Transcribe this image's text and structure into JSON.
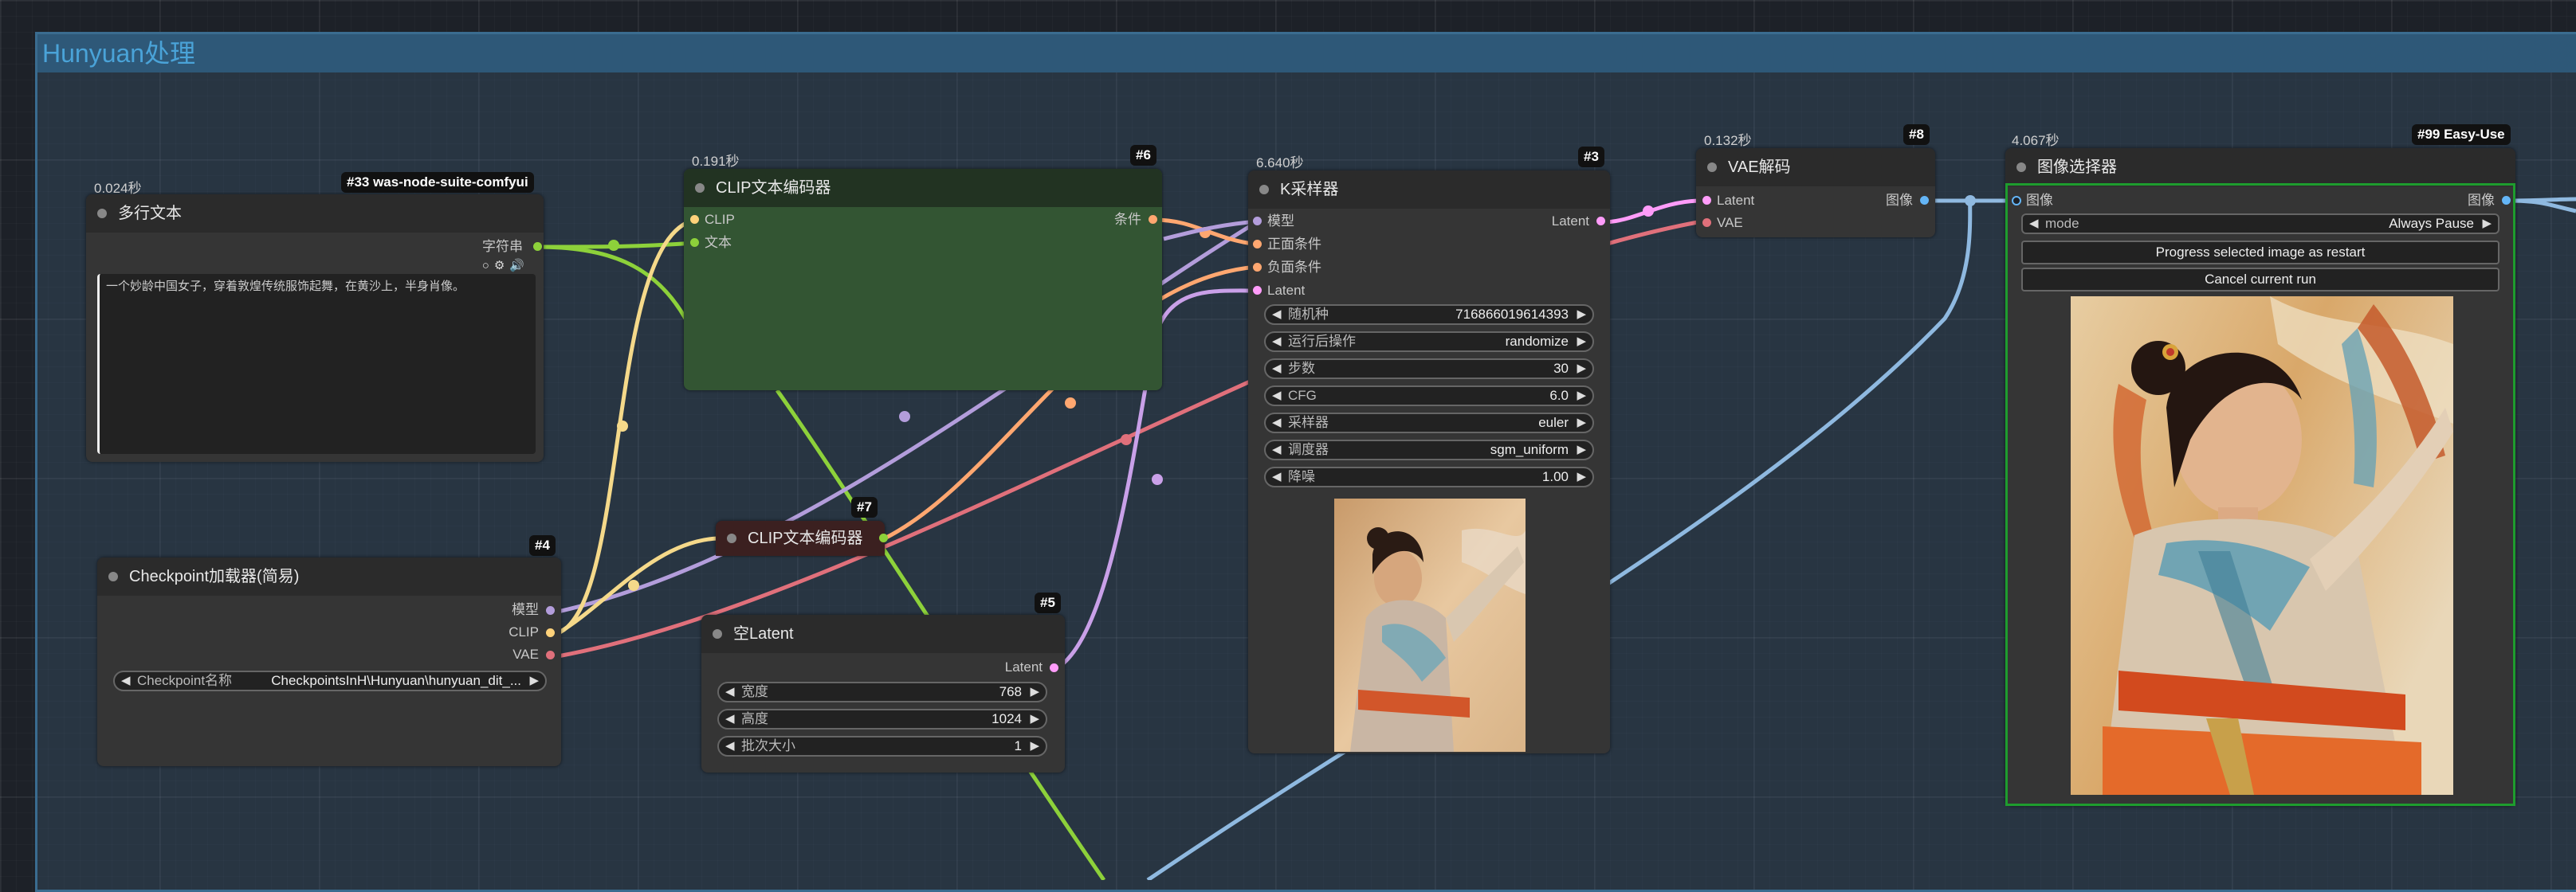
{
  "group": {
    "title": "Hunyuan处理"
  },
  "colors": {
    "clip": "#ffd27a",
    "model": "#b39ddb",
    "vae": "#e0707b",
    "conditioning": "#ffa770",
    "latent": "#ff9cf9",
    "string": "#8dd13a",
    "image": "#64b5f6"
  },
  "nodes": {
    "text_multiline": {
      "timing": "0.024秒",
      "badge": "#33 was-node-suite-comfyui",
      "title": "多行文本",
      "output_label": "字符串",
      "text": "一个妙龄中国女子，穿着敦煌传统服饰起舞，在黄沙上，半身肖像。",
      "icons": [
        "circle-icon",
        "gear-icon",
        "speaker-icon"
      ]
    },
    "clip_encode_6": {
      "timing": "0.191秒",
      "badge": "#6",
      "title": "CLIP文本编码器",
      "input_clip": "CLIP",
      "input_text": "文本",
      "output": "条件"
    },
    "ksampler": {
      "timing": "6.640秒",
      "badge": "#3",
      "title": "K采样器",
      "inputs": [
        "模型",
        "正面条件",
        "负面条件",
        "Latent"
      ],
      "output": "Latent",
      "widgets": [
        {
          "label": "随机种",
          "value": "716866019614393"
        },
        {
          "label": "运行后操作",
          "value": "randomize"
        },
        {
          "label": "步数",
          "value": "30"
        },
        {
          "label": "CFG",
          "value": "6.0"
        },
        {
          "label": "采样器",
          "value": "euler"
        },
        {
          "label": "调度器",
          "value": "sgm_uniform"
        },
        {
          "label": "降噪",
          "value": "1.00"
        }
      ]
    },
    "vae_decode": {
      "timing": "0.132秒",
      "badge": "#8",
      "title": "VAE解码",
      "inputs": [
        "Latent",
        "VAE"
      ],
      "output": "图像"
    },
    "image_chooser": {
      "timing": "4.067秒",
      "badge": "#99 Easy-Use",
      "title": "图像选择器",
      "input": "图像",
      "output": "图像",
      "mode_label": "mode",
      "mode_value": "Always Pause",
      "button_restart": "Progress selected image as restart",
      "button_cancel": "Cancel current run"
    },
    "checkpoint": {
      "badge": "#4",
      "title": "Checkpoint加载器(简易)",
      "outputs": [
        "模型",
        "CLIP",
        "VAE"
      ],
      "widget_label": "Checkpoint名称",
      "widget_value": "CheckpointsInH\\Hunyuan\\hunyuan_dit_..."
    },
    "clip_encode_7": {
      "badge": "#7",
      "title": "CLIP文本编码器"
    },
    "empty_latent": {
      "badge": "#5",
      "title": "空Latent",
      "output": "Latent",
      "widgets": [
        {
          "label": "宽度",
          "value": "768"
        },
        {
          "label": "高度",
          "value": "1024"
        },
        {
          "label": "批次大小",
          "value": "1"
        }
      ]
    }
  }
}
